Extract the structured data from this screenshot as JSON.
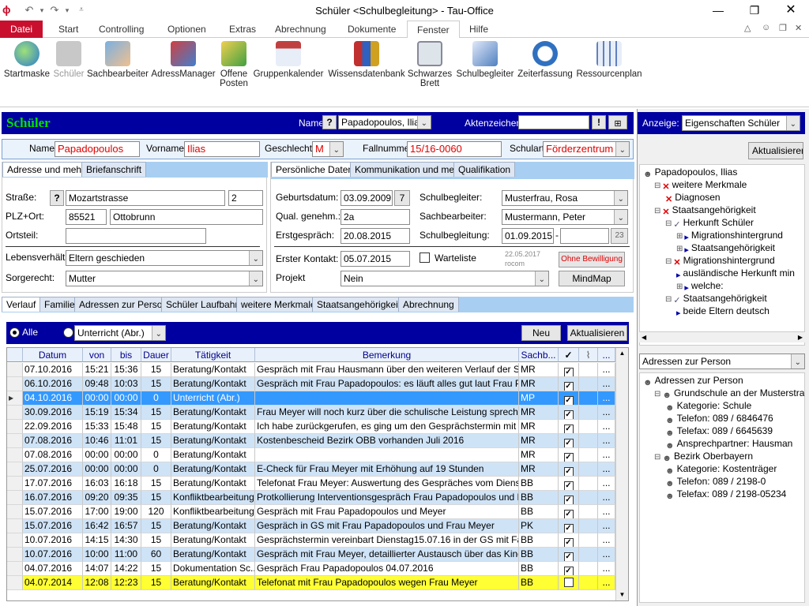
{
  "window": {
    "title": "Schüler <Schulbegleitung> - Tau-Office"
  },
  "ribbon": {
    "tabs": [
      "Datei",
      "Start",
      "Controlling",
      "Optionen",
      "Extras",
      "Abrechnung",
      "Dokumente",
      "Fenster",
      "Hilfe"
    ],
    "active_tab": "Fenster",
    "buttons": [
      {
        "label": "Startmaske",
        "icon": "globe-icon"
      },
      {
        "label": "Schüler",
        "icon": "student-icon"
      },
      {
        "label": "Sachbearbeiter",
        "icon": "people-icon"
      },
      {
        "label": "AdressManager",
        "icon": "address-book-icon"
      },
      {
        "label": "Offene\nPosten",
        "icon": "list-icon"
      },
      {
        "label": "Gruppenkalender",
        "icon": "calendar-icon"
      },
      {
        "label": "Wissensdatenbank",
        "icon": "books-icon"
      },
      {
        "label": "Schwarzes\nBrett",
        "icon": "board-icon"
      },
      {
        "label": "Schulbegleiter",
        "icon": "document-icon"
      },
      {
        "label": "Zeiterfassung",
        "icon": "stopwatch-icon"
      },
      {
        "label": "Ressourcenplan",
        "icon": "grid-icon"
      }
    ]
  },
  "header": {
    "title": "Schüler",
    "name_label": "Name",
    "name_help": "?",
    "name_value": "Papadopoulos, Ilias",
    "akten_label": "Aktenzeichen",
    "akten_value": "",
    "excl": "!"
  },
  "person": {
    "name_label": "Name",
    "name": "Papadopoulos",
    "vorname_label": "Vorname",
    "vorname": "Ilias",
    "geschlecht_label": "Geschlecht",
    "geschlecht": "M",
    "fallnummer_label": "Fallnummer",
    "fallnummer": "15/16-0060",
    "schulart_label": "Schulart",
    "schulart": "Förderzentrum"
  },
  "left_tabs": [
    "Adresse und mehr",
    "Briefanschrift"
  ],
  "address": {
    "strasse_label": "Straße:",
    "help": "?",
    "strasse": "Mozartstrasse",
    "hausnr": "2",
    "plz_label": "PLZ+Ort:",
    "plz": "85521",
    "ort": "Ottobrunn",
    "ortsteil_label": "Ortsteil:",
    "ortsteil": "",
    "leben_label": "Lebensverhält nisse:",
    "leben": "Eltern geschieden",
    "sorge_label": "Sorgerecht:",
    "sorge": "Mutter"
  },
  "right_tabs": [
    "Persönliche Daten",
    "Kommunikation und mehr",
    "Qualifikation"
  ],
  "personal": {
    "geb_label": "Geburtsdatum:",
    "geb": "03.09.2009",
    "age": "7",
    "qual_label": "Qual. genehm.:",
    "qual": "2a",
    "erst_label": "Erstgespräch:",
    "erst": "20.08.2015",
    "kontakt_label": "Erster Kontakt:",
    "kontakt": "05.07.2015",
    "warte_label": "Warteliste",
    "projekt_label": "Projekt",
    "projekt": "Nein",
    "sb_label": "Schulbegleiter:",
    "sb": "Musterfrau, Rosa",
    "sach_label": "Sachbearbeiter:",
    "sach": "Mustermann, Peter",
    "sbg_label": "Schulbegleitung:",
    "sbg_from": "01.09.2015",
    "sbg_dash": "-",
    "sbg_to": "",
    "sbg_btn": "23",
    "stamp": "22.05.2017",
    "stamp_user": "rocom",
    "ohne": "Ohne Bewilligung",
    "mindmap": "MindMap"
  },
  "bottom_tabs": [
    "Verlauf",
    "Familie",
    "Adressen zur Person",
    "Schüler Laufbahn",
    "weitere Merkmale",
    "Staatsangehörigkeit",
    "Abrechnung"
  ],
  "verlauf": {
    "radio_all": "Alle",
    "filter": "Unterricht (Abr.)",
    "neu": "Neu",
    "aktualisieren": "Aktualisieren",
    "columns": [
      "Datum",
      "von",
      "bis",
      "Dauer",
      "Tätigkeit",
      "Bemerkung",
      "Sachb...",
      "✓",
      "📎",
      "..."
    ],
    "rows": [
      {
        "datum": "07.10.2016",
        "von": "15:21",
        "bis": "15:36",
        "dauer": "15",
        "taet": "Beratung/Kontakt",
        "bem": "Gespräch mit Frau Hausmann über den weiteren Verlauf der SB im...",
        "sb": "MR",
        "chk": true,
        "style": "w"
      },
      {
        "datum": "06.10.2016",
        "von": "09:48",
        "bis": "10:03",
        "dauer": "15",
        "taet": "Beratung/Kontakt",
        "bem": "Gespräch mit Frau Papadopoulos: es läuft alles gut laut Frau Papa...",
        "sb": "MR",
        "chk": true,
        "style": "b"
      },
      {
        "datum": "04.10.2016",
        "von": "00:00",
        "bis": "00:00",
        "dauer": "0",
        "taet": "Unterricht (Abr.)",
        "bem": "",
        "sb": "MP",
        "chk": true,
        "style": "sel"
      },
      {
        "datum": "30.09.2016",
        "von": "15:19",
        "bis": "15:34",
        "dauer": "15",
        "taet": "Beratung/Kontakt",
        "bem": "Frau Meyer will noch kurz über die schulische Leistung sprechen: e...",
        "sb": "MR",
        "chk": true,
        "style": "b"
      },
      {
        "datum": "22.09.2016",
        "von": "15:33",
        "bis": "15:48",
        "dauer": "15",
        "taet": "Beratung/Kontakt",
        "bem": "Ich habe zurückgerufen, es ging um den Gesprächstermin mit Ihnen",
        "sb": "MR",
        "chk": true,
        "style": "w"
      },
      {
        "datum": "07.08.2016",
        "von": "10:46",
        "bis": "11:01",
        "dauer": "15",
        "taet": "Beratung/Kontakt",
        "bem": "Kostenbescheid Bezirk OBB vorhanden Juli 2016",
        "sb": "MR",
        "chk": true,
        "style": "b"
      },
      {
        "datum": "07.08.2016",
        "von": "00:00",
        "bis": "00:00",
        "dauer": "0",
        "taet": "Beratung/Kontakt",
        "bem": "",
        "sb": "MR",
        "chk": true,
        "style": "w"
      },
      {
        "datum": "25.07.2016",
        "von": "00:00",
        "bis": "00:00",
        "dauer": "0",
        "taet": "Beratung/Kontakt",
        "bem": "E-Check für Frau Meyer mit Erhöhung auf 19 Stunden",
        "sb": "MR",
        "chk": true,
        "style": "b"
      },
      {
        "datum": "17.07.2016",
        "von": "16:03",
        "bis": "16:18",
        "dauer": "15",
        "taet": "Beratung/Kontakt",
        "bem": "Telefonat Frau Meyer: Auswertung des Gespräches vom Dienstag...",
        "sb": "BB",
        "chk": true,
        "style": "w"
      },
      {
        "datum": "16.07.2016",
        "von": "09:20",
        "bis": "09:35",
        "dauer": "15",
        "taet": "Konfliktbearbeitung",
        "bem": "Protkollierung Interventionsgespräch Frau Papadopoulos und Fra...",
        "sb": "BB",
        "chk": true,
        "style": "b"
      },
      {
        "datum": "15.07.2016",
        "von": "17:00",
        "bis": "19:00",
        "dauer": "120",
        "taet": "Konfliktbearbeitung",
        "bem": "Gespräch mit Frau Papadopoulos und Meyer",
        "sb": "BB",
        "chk": true,
        "style": "w"
      },
      {
        "datum": "15.07.2016",
        "von": "16:42",
        "bis": "16:57",
        "dauer": "15",
        "taet": "Beratung/Kontakt",
        "bem": "Gespräch in GS mit Frau Papadopoulos und Frau Meyer",
        "sb": "PK",
        "chk": true,
        "style": "b"
      },
      {
        "datum": "10.07.2016",
        "von": "14:15",
        "bis": "14:30",
        "dauer": "15",
        "taet": "Beratung/Kontakt",
        "bem": "Gesprächstermin vereinbart Dienstag15.07.16 in der GS mit Famili...",
        "sb": "BB",
        "chk": true,
        "style": "w"
      },
      {
        "datum": "10.07.2016",
        "von": "10:00",
        "bis": "11:00",
        "dauer": "60",
        "taet": "Beratung/Kontakt",
        "bem": "Gespräch mit Frau Meyer, detaillierter Austausch über das Kind un...",
        "sb": "BB",
        "chk": true,
        "style": "b"
      },
      {
        "datum": "04.07.2016",
        "von": "14:07",
        "bis": "14:22",
        "dauer": "15",
        "taet": "Dokumentation Sc...",
        "bem": "Gespräch Frau Papadopoulos 04.07.2016",
        "sb": "BB",
        "chk": true,
        "style": "w"
      },
      {
        "datum": "04.07.2014",
        "von": "12:08",
        "bis": "12:23",
        "dauer": "15",
        "taet": "Beratung/Kontakt",
        "bem": "Telefonat mit Frau Papadopoulos wegen Frau Meyer",
        "sb": "BB",
        "chk": false,
        "style": "y"
      }
    ]
  },
  "side": {
    "anzeige_label": "Anzeige:",
    "anzeige": "Eigenschaften Schüler",
    "aktualisieren": "Aktualisieren",
    "tree1": [
      {
        "text": "Papadopoulos, Ilias",
        "lvl": 0,
        "icon": "person-icon"
      },
      {
        "text": "weitere Merkmale",
        "lvl": 1,
        "icon": "red-x-icon",
        "exp": "−"
      },
      {
        "text": "Diagnosen",
        "lvl": 2,
        "icon": "red-x-icon"
      },
      {
        "text": "Staatsangehörigkeit",
        "lvl": 1,
        "icon": "red-x-icon",
        "exp": "−"
      },
      {
        "text": "Herkunft Schüler",
        "lvl": 2,
        "icon": "check-icon",
        "exp": "−"
      },
      {
        "text": "Migrationshintergrund",
        "lvl": 3,
        "icon": "arrow-icon",
        "exp": "+"
      },
      {
        "text": "Staatsangehörigkeit",
        "lvl": 3,
        "icon": "arrow-icon",
        "exp": "+"
      },
      {
        "text": "Migrationshintergrund",
        "lvl": 2,
        "icon": "red-x-icon",
        "exp": "−"
      },
      {
        "text": "ausländische Herkunft min",
        "lvl": 3,
        "icon": "arrow-icon"
      },
      {
        "text": "welche:",
        "lvl": 3,
        "icon": "arrow-icon",
        "exp": "+"
      },
      {
        "text": "Staatsangehörigkeit",
        "lvl": 2,
        "icon": "check-icon",
        "exp": "−"
      },
      {
        "text": "beide Eltern deutsch",
        "lvl": 3,
        "icon": "arrow-icon"
      }
    ],
    "adressen_select": "Adressen zur Person",
    "tree2": [
      {
        "text": "Adressen zur Person",
        "lvl": 0,
        "icon": "person-icon"
      },
      {
        "text": "Grundschule an der Musterstraß",
        "lvl": 1,
        "icon": "person-icon",
        "exp": "−"
      },
      {
        "text": "Kategorie: Schule",
        "lvl": 2,
        "icon": "person-icon"
      },
      {
        "text": "Telefon: 089 / 6846476",
        "lvl": 2,
        "icon": "person-icon"
      },
      {
        "text": "Telefax: 089 / 6645639",
        "lvl": 2,
        "icon": "person-icon"
      },
      {
        "text": "Ansprechpartner: Hausman",
        "lvl": 2,
        "icon": "person-icon"
      },
      {
        "text": "Bezirk Oberbayern",
        "lvl": 1,
        "icon": "person-icon",
        "exp": "−"
      },
      {
        "text": "Kategorie: Kostenträger",
        "lvl": 2,
        "icon": "person-icon"
      },
      {
        "text": "Telefon: 089 / 2198-0",
        "lvl": 2,
        "icon": "person-icon"
      },
      {
        "text": "Telefax: 089 / 2198-05234",
        "lvl": 2,
        "icon": "person-icon"
      }
    ]
  },
  "colors": {
    "blue_header": "#0000a0",
    "accent_green": "#00e000",
    "red_text": "#e00000",
    "row_blue": "#cfe3f7",
    "row_sel": "#3399ff",
    "row_yellow": "#ffff33"
  }
}
